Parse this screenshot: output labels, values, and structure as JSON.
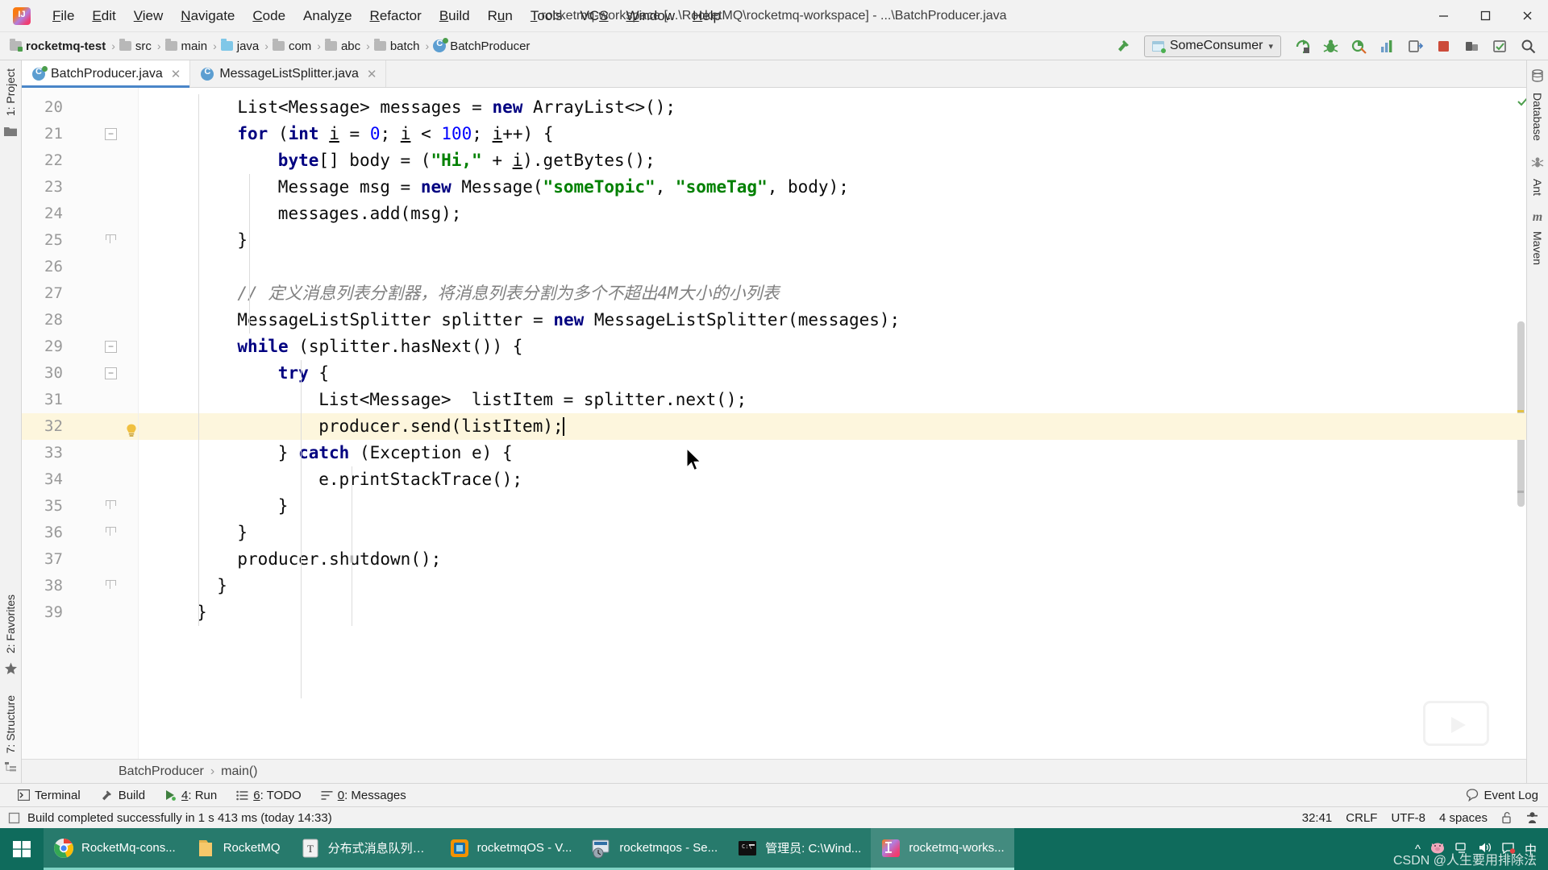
{
  "window": {
    "title": "rocketmq-workspace [...\\RocketMQ\\rocketmq-workspace] - ...\\BatchProducer.java",
    "minimize": "─",
    "maximize": "☐",
    "close": "✕"
  },
  "menu": {
    "items": [
      {
        "label": "File",
        "mnemonic": "F"
      },
      {
        "label": "Edit",
        "mnemonic": "E"
      },
      {
        "label": "View",
        "mnemonic": "V"
      },
      {
        "label": "Navigate",
        "mnemonic": "N"
      },
      {
        "label": "Code",
        "mnemonic": "C"
      },
      {
        "label": "Analyze",
        "mnemonic": "z"
      },
      {
        "label": "Refactor",
        "mnemonic": "R"
      },
      {
        "label": "Build",
        "mnemonic": "B"
      },
      {
        "label": "Run",
        "mnemonic": "u"
      },
      {
        "label": "Tools",
        "mnemonic": "T"
      },
      {
        "label": "VCS",
        "mnemonic": "S"
      },
      {
        "label": "Window",
        "mnemonic": "W"
      },
      {
        "label": "Help",
        "mnemonic": "H"
      }
    ]
  },
  "navbar": {
    "crumbs": [
      {
        "label": "rocketmq-test",
        "icon": "module-folder-icon"
      },
      {
        "label": "src",
        "icon": "folder-icon"
      },
      {
        "label": "main",
        "icon": "folder-icon"
      },
      {
        "label": "java",
        "icon": "source-folder-icon"
      },
      {
        "label": "com",
        "icon": "package-folder-icon"
      },
      {
        "label": "abc",
        "icon": "package-folder-icon"
      },
      {
        "label": "batch",
        "icon": "package-folder-icon"
      },
      {
        "label": "BatchProducer",
        "icon": "java-class-icon"
      }
    ],
    "separator": "›",
    "run_config": "SomeConsumer",
    "right_icons": [
      "build-hammer-icon",
      "rerun-icon",
      "debug-icon",
      "coverage-icon",
      "profiler-icon",
      "attach-icon",
      "stop-icon",
      "git-update-icon",
      "commit-icon",
      "search-everywhere-icon"
    ]
  },
  "tabs": [
    {
      "label": "BatchProducer.java",
      "active": true,
      "close": "✕"
    },
    {
      "label": "MessageListSplitter.java",
      "active": false,
      "close": "✕"
    }
  ],
  "sidebar_left": [
    {
      "label": "1: Project",
      "mnemonic": "1",
      "icon": "project-folder-icon"
    },
    {
      "label": "2: Favorites",
      "mnemonic": "2",
      "icon": "star-icon"
    },
    {
      "label": "7: Structure",
      "mnemonic": "7",
      "icon": "structure-icon"
    }
  ],
  "sidebar_right": [
    {
      "label": "Database",
      "icon": "database-icon"
    },
    {
      "label": "Ant",
      "icon": "ant-icon"
    },
    {
      "label": "Maven",
      "icon": "maven-icon"
    }
  ],
  "editor": {
    "first_line": 20,
    "highlight_line": 32,
    "caret_line": 32,
    "lines": [
      {
        "n": 20,
        "fold": "",
        "bulb": false,
        "code": "    List<Message> messages = new ArrayList<>();"
      },
      {
        "n": 21,
        "fold": "open",
        "bulb": false,
        "code": "    for (int i = 0; i < 100; i++) {"
      },
      {
        "n": 22,
        "fold": "",
        "bulb": false,
        "code": "        byte[] body = (\"Hi,\" + i).getBytes();"
      },
      {
        "n": 23,
        "fold": "",
        "bulb": false,
        "code": "        Message msg = new Message(\"someTopic\", \"someTag\", body);"
      },
      {
        "n": 24,
        "fold": "",
        "bulb": false,
        "code": "        messages.add(msg);"
      },
      {
        "n": 25,
        "fold": "close",
        "bulb": false,
        "code": "    }"
      },
      {
        "n": 26,
        "fold": "",
        "bulb": false,
        "code": ""
      },
      {
        "n": 27,
        "fold": "",
        "bulb": false,
        "code": "    // 定义消息列表分割器，将消息列表分割为多个不超出4M大小的小列表"
      },
      {
        "n": 28,
        "fold": "",
        "bulb": false,
        "code": "    MessageListSplitter splitter = new MessageListSplitter(messages);"
      },
      {
        "n": 29,
        "fold": "open",
        "bulb": false,
        "code": "    while (splitter.hasNext()) {"
      },
      {
        "n": 30,
        "fold": "open",
        "bulb": false,
        "code": "        try {"
      },
      {
        "n": 31,
        "fold": "",
        "bulb": false,
        "code": "            List<Message>  listItem = splitter.next();"
      },
      {
        "n": 32,
        "fold": "",
        "bulb": true,
        "code": "            producer.send(listItem);"
      },
      {
        "n": 33,
        "fold": "",
        "bulb": false,
        "code": "        } catch (Exception e) {"
      },
      {
        "n": 34,
        "fold": "",
        "bulb": false,
        "code": "            e.printStackTrace();"
      },
      {
        "n": 35,
        "fold": "close",
        "bulb": false,
        "code": "        }"
      },
      {
        "n": 36,
        "fold": "close",
        "bulb": false,
        "code": "    }"
      },
      {
        "n": 37,
        "fold": "",
        "bulb": false,
        "code": "    producer.shutdown();"
      },
      {
        "n": 38,
        "fold": "close",
        "bulb": false,
        "code": "  }"
      },
      {
        "n": 39,
        "fold": "",
        "bulb": false,
        "code": "}"
      }
    ],
    "breadcrumb": [
      "BatchProducer",
      "main()"
    ],
    "breadcrumb_sep": "›"
  },
  "toolwindows": [
    {
      "label": "Terminal",
      "icon": "terminal-icon",
      "mnemonic": ""
    },
    {
      "label": "Build",
      "icon": "hammer-icon",
      "mnemonic": ""
    },
    {
      "label": "4: Run",
      "icon": "run-icon",
      "mnemonic": "4"
    },
    {
      "label": "6: TODO",
      "icon": "todo-icon",
      "mnemonic": "6"
    },
    {
      "label": "0: Messages",
      "icon": "messages-icon",
      "mnemonic": "0"
    }
  ],
  "event_log": "Event Log",
  "status": {
    "message": "Build completed successfully in 1 s 413 ms (today 14:33)",
    "caret_position": "32:41",
    "line_separator": "CRLF",
    "encoding": "UTF-8",
    "indent": "4 spaces",
    "lock_icon": "unlocked-icon",
    "inspector_icon": "hector-icon"
  },
  "taskbar": {
    "start": "windows-start-icon",
    "items": [
      {
        "label": "RocketMq-cons...",
        "icon": "chrome-icon",
        "state": "open"
      },
      {
        "label": "RocketMQ",
        "icon": "folder-icon",
        "state": "open"
      },
      {
        "label": "分布式消息队列R...",
        "icon": "typora-icon",
        "state": "open"
      },
      {
        "label": "rocketmqOS - V...",
        "icon": "vmware-icon",
        "state": "open"
      },
      {
        "label": "rocketmqos - Se...",
        "icon": "xshell-icon",
        "state": "open"
      },
      {
        "label": "管理员: C:\\Wind...",
        "icon": "cmd-icon",
        "state": "open"
      },
      {
        "label": "rocketmq-works...",
        "icon": "intellij-icon",
        "state": "active"
      }
    ],
    "tray": [
      "chevron-up-icon",
      "pig-icon",
      "network-icon",
      "volume-icon",
      "notification-icon",
      "ime-icon"
    ],
    "watermark": "CSDN @人生要用排除法"
  },
  "colors": {
    "accent": "#4a86c8",
    "taskbar": "#0f6b5c",
    "keyword": "#000080",
    "string": "#008000",
    "comment": "#808080",
    "number": "#0000ff",
    "highlight": "#fdf6dd"
  }
}
